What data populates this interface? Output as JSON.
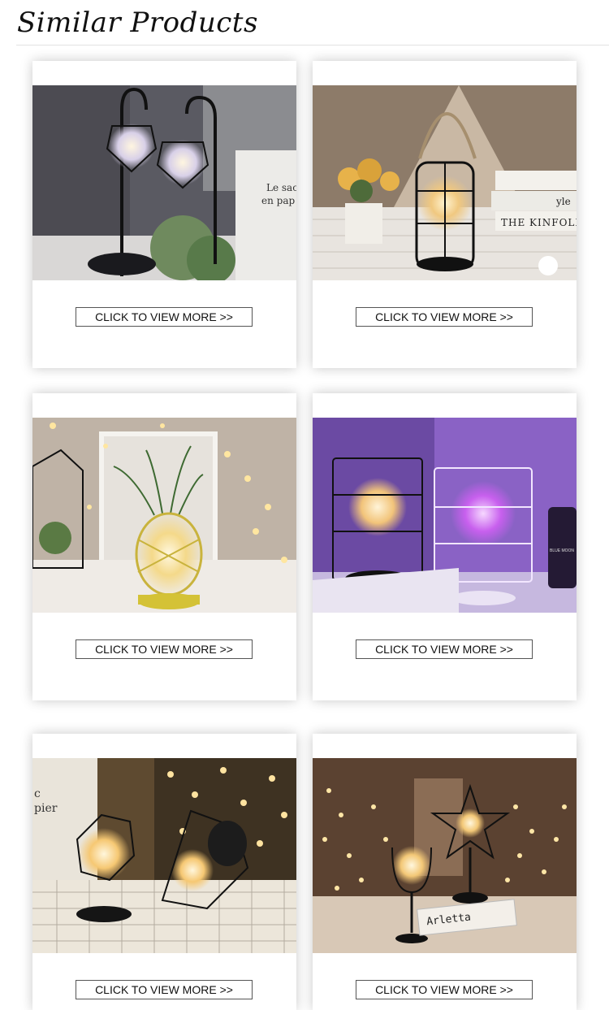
{
  "header": {
    "title": "Similar Products"
  },
  "products": [
    {
      "cta": "CLICK TO VIEW MORE >>",
      "photo": "geometric-lantern-lamps-photo"
    },
    {
      "cta": "CLICK TO VIEW MORE >>",
      "photo": "cage-jar-lamp-photo"
    },
    {
      "cta": "CLICK TO VIEW MORE >>",
      "photo": "pineapple-lamp-photo"
    },
    {
      "cta": "CLICK TO VIEW MORE >>",
      "photo": "bulb-cage-lamps-photo"
    },
    {
      "cta": "CLICK TO VIEW MORE >>",
      "photo": "polygon-lamps-photo"
    },
    {
      "cta": "CLICK TO VIEW MORE >>",
      "photo": "star-and-goblet-lamps-photo"
    }
  ],
  "photo_text": {
    "p1": "Le sac",
    "p1b": "en pap",
    "p2a": "THE KINFOLK",
    "p2b": "yle",
    "p4": "BLUE MOON",
    "p5a": "c",
    "p5b": "pier",
    "p6": "Arletta"
  }
}
